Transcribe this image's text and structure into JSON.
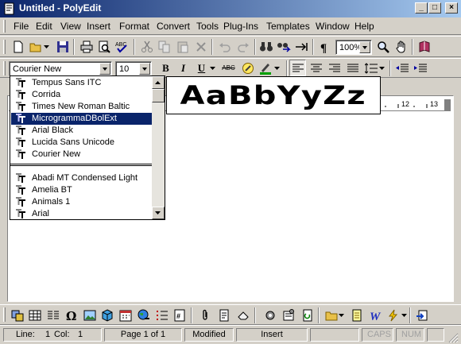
{
  "window": {
    "title": "Untitled - PolyEdit",
    "buttons": {
      "minimize": "_",
      "maximize": "□",
      "close": "×"
    }
  },
  "menubar": {
    "items": [
      "File",
      "Edit",
      "View",
      "Insert",
      "Format",
      "Convert",
      "Tools",
      "Plug-Ins",
      "Templates",
      "Window",
      "Help"
    ]
  },
  "toolbar_standard": {
    "zoom_value": "100%"
  },
  "toolbar_format": {
    "font_value": "Courier New",
    "size_value": "10",
    "bold_label": "B",
    "italic_label": "I",
    "underline_label": "U",
    "strike_label": "ABC"
  },
  "font_list": {
    "recent": [
      "Tempus Sans ITC",
      "Corrida",
      "Times New Roman Baltic",
      "MicrogrammaDBolExt",
      "Arial Black",
      "Lucida Sans Unicode",
      "Courier New"
    ],
    "all": [
      "Abadi MT Condensed Light",
      "Amelia BT",
      "Animals 1",
      "Arial"
    ],
    "selected": "MicrogrammaDBolExt",
    "icon": "truetype-icon"
  },
  "font_preview": {
    "sample": "AaBbYyZz"
  },
  "ruler": {
    "labels": [
      "12",
      "13"
    ]
  },
  "statusbar": {
    "line_label": "Line:",
    "line_value": "1",
    "col_label": "Col:",
    "col_value": "1",
    "page": "Page 1 of 1",
    "modified": "Modified",
    "insert": "Insert",
    "caps": "CAPS",
    "num": "NUM"
  },
  "colors": {
    "face": "#d4d0c8",
    "title_start": "#0a246a",
    "title_end": "#a6caf0",
    "selection": "#0a246a"
  }
}
